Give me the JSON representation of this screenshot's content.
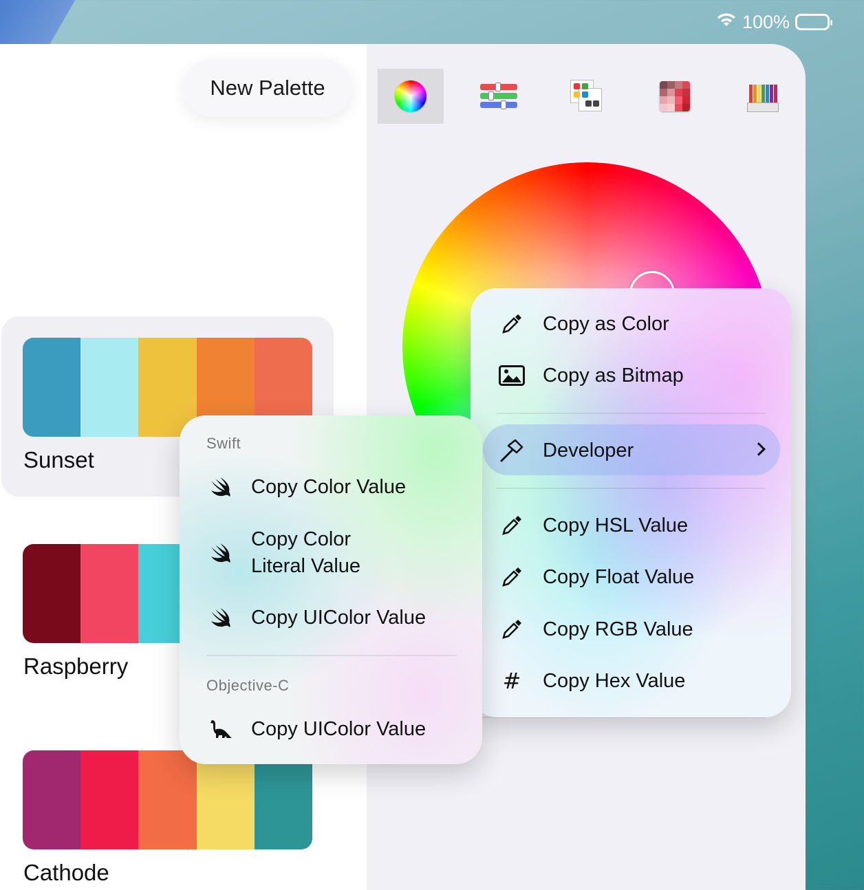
{
  "status_bar": {
    "battery_percent": "100%",
    "wifi_icon": "wifi-icon",
    "battery_icon": "battery-icon"
  },
  "sidebar": {
    "new_palette_label": "New Palette",
    "palettes": [
      {
        "name": "Sunset",
        "colors": [
          "#3b9cc0",
          "#a8ecf1",
          "#efc23e",
          "#ef8233",
          "#ee6d4e"
        ]
      },
      {
        "name": "Raspberry",
        "colors": [
          "#780a1c",
          "#f24561",
          "#47cfd9",
          "#ededed",
          "#ededed"
        ]
      },
      {
        "name": "Cathode",
        "colors": [
          "#a1276f",
          "#ef1c4a",
          "#f26c45",
          "#f5da64",
          "#2e9597"
        ]
      }
    ]
  },
  "toolbar": {
    "tabs": [
      {
        "name": "color-wheel",
        "icon": "color-wheel-icon",
        "active": true
      },
      {
        "name": "sliders",
        "icon": "rgb-sliders-icon",
        "active": false
      },
      {
        "name": "grid-picker",
        "icon": "color-grid-icon",
        "active": false
      },
      {
        "name": "image-picker",
        "icon": "mosaic-icon",
        "active": false
      },
      {
        "name": "pencils",
        "icon": "colored-pencils-icon",
        "active": false
      }
    ]
  },
  "context_menu": {
    "items": [
      {
        "label": "Copy as Color",
        "icon": "eyedropper-icon"
      },
      {
        "label": "Copy as Bitmap",
        "icon": "photo-icon"
      },
      {
        "label": "Developer",
        "icon": "hammer-icon",
        "submenu": true
      },
      {
        "label": "Copy HSL Value",
        "icon": "eyedropper-icon"
      },
      {
        "label": "Copy Float Value",
        "icon": "eyedropper-icon"
      },
      {
        "label": "Copy RGB Value",
        "icon": "eyedropper-icon"
      },
      {
        "label": "Copy Hex Value",
        "icon": "hash-icon"
      }
    ]
  },
  "developer_submenu": {
    "swift_header": "Swift",
    "swift_items": [
      {
        "label": "Copy Color Value",
        "icon": "swift-icon"
      },
      {
        "label_line1": "Copy Color",
        "label_line2": "Literal Value",
        "icon": "swift-icon"
      },
      {
        "label": "Copy UIColor Value",
        "icon": "swift-icon"
      }
    ],
    "objc_header": "Objective-C",
    "objc_items": [
      {
        "label": "Copy UIColor Value",
        "icon": "dinosaur-icon"
      }
    ]
  }
}
